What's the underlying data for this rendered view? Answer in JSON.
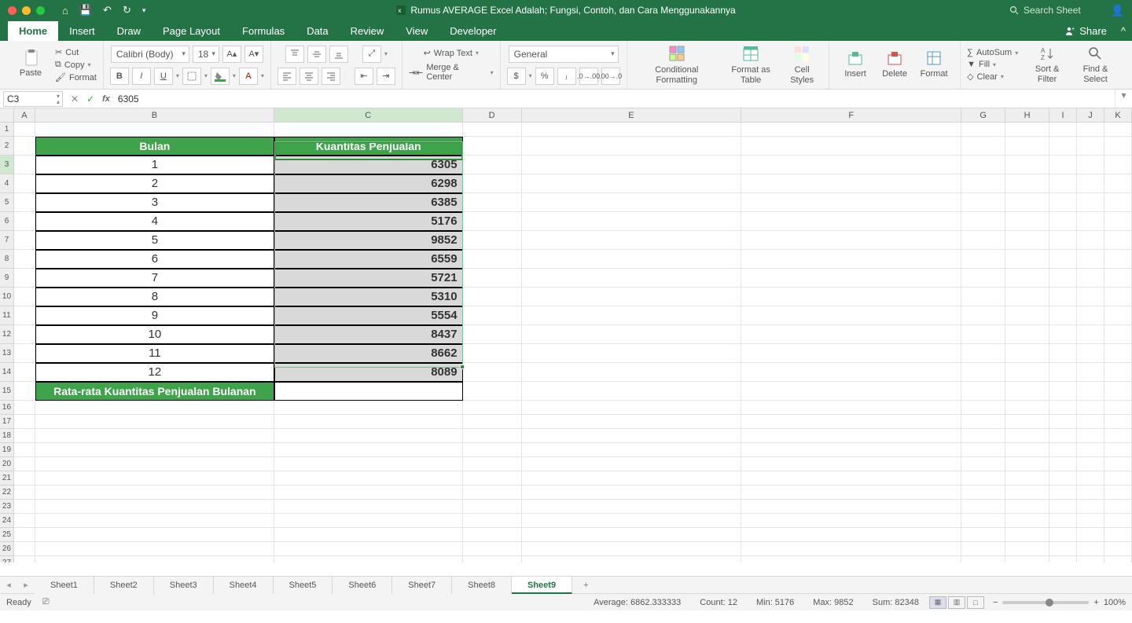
{
  "window": {
    "title": "Rumus AVERAGE Excel Adalah; Fungsi, Contoh, dan Cara Menggunakannya",
    "search_placeholder": "Search Sheet"
  },
  "tabs": [
    "Home",
    "Insert",
    "Draw",
    "Page Layout",
    "Formulas",
    "Data",
    "Review",
    "View",
    "Developer"
  ],
  "active_tab": "Home",
  "share_label": "Share",
  "ribbon": {
    "paste": "Paste",
    "cut": "Cut",
    "copy": "Copy",
    "format_p": "Format",
    "font_name": "Calibri (Body)",
    "font_size": "18",
    "bold": "B",
    "italic": "I",
    "underline": "U",
    "wrap": "Wrap Text",
    "merge": "Merge & Center",
    "number_format": "General",
    "cond_format": "Conditional Formatting",
    "as_table": "Format as Table",
    "cell_styles": "Cell Styles",
    "insert": "Insert",
    "delete": "Delete",
    "format": "Format",
    "autosum": "AutoSum",
    "fill": "Fill",
    "clear": "Clear",
    "sort": "Sort & Filter",
    "find": "Find & Select"
  },
  "formula_bar": {
    "cell_ref": "C3",
    "value": "6305"
  },
  "columns": [
    "A",
    "B",
    "C",
    "D",
    "E",
    "F",
    "G",
    "H",
    "I",
    "J",
    "K"
  ],
  "table": {
    "header_b": "Bulan",
    "header_c": "Kuantitas Penjualan",
    "footer_b": "Rata-rata Kuantitas Penjualan Bulanan",
    "rows": [
      {
        "b": "1",
        "c": "6305"
      },
      {
        "b": "2",
        "c": "6298"
      },
      {
        "b": "3",
        "c": "6385"
      },
      {
        "b": "4",
        "c": "5176"
      },
      {
        "b": "5",
        "c": "9852"
      },
      {
        "b": "6",
        "c": "6559"
      },
      {
        "b": "7",
        "c": "5721"
      },
      {
        "b": "8",
        "c": "5310"
      },
      {
        "b": "9",
        "c": "5554"
      },
      {
        "b": "10",
        "c": "8437"
      },
      {
        "b": "11",
        "c": "8662"
      },
      {
        "b": "12",
        "c": "8089"
      }
    ]
  },
  "sheets": [
    "Sheet1",
    "Sheet2",
    "Sheet3",
    "Sheet4",
    "Sheet5",
    "Sheet6",
    "Sheet7",
    "Sheet8",
    "Sheet9"
  ],
  "active_sheet": "Sheet9",
  "status": {
    "ready": "Ready",
    "average": "Average: 6862.333333",
    "count": "Count: 12",
    "min": "Min: 5176",
    "max": "Max: 9852",
    "sum": "Sum: 82348",
    "zoom": "100%"
  }
}
